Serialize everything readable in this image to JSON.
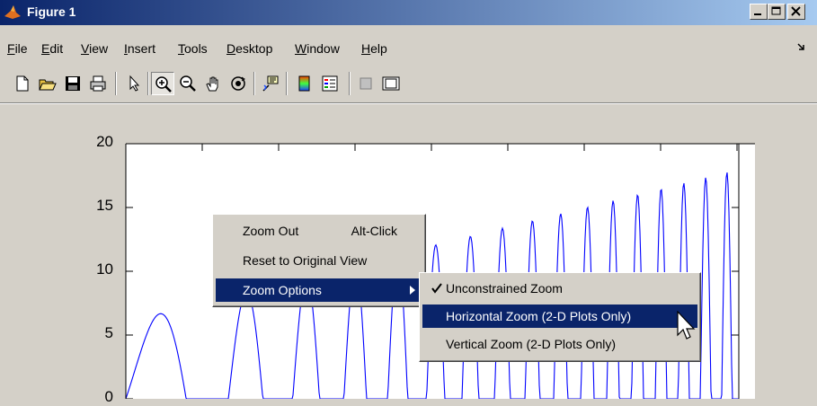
{
  "window": {
    "title": "Figure 1"
  },
  "menubar": [
    {
      "id": "file",
      "label": "File",
      "key": "F",
      "rest": "ile",
      "x": 8
    },
    {
      "id": "edit",
      "label": "Edit",
      "key": "E",
      "rest": "dit",
      "x": 46
    },
    {
      "id": "view",
      "label": "View",
      "key": "V",
      "rest": "iew",
      "x": 90
    },
    {
      "id": "insert",
      "label": "Insert",
      "key": "I",
      "rest": "nsert",
      "x": 138
    },
    {
      "id": "tools",
      "label": "Tools",
      "key": "T",
      "rest": "ools",
      "x": 198
    },
    {
      "id": "desktop",
      "label": "Desktop",
      "key": "D",
      "rest": "esktop",
      "x": 252
    },
    {
      "id": "window",
      "label": "Window",
      "key": "W",
      "rest": "indow",
      "x": 328
    },
    {
      "id": "help",
      "label": "Help",
      "key": "H",
      "rest": "elp",
      "x": 402
    }
  ],
  "context_menu": {
    "items": [
      {
        "label": "Zoom Out",
        "accel": "Alt-Click"
      },
      {
        "label": "Reset to Original View",
        "accel": ""
      },
      {
        "label": "Zoom Options",
        "accel": "",
        "submenu": true,
        "highlighted": true
      }
    ]
  },
  "zoom_submenu": {
    "items": [
      {
        "label": "Unconstrained Zoom",
        "checked": true,
        "highlighted": false
      },
      {
        "label": "Horizontal Zoom (2-D Plots Only)",
        "checked": false,
        "highlighted": true
      },
      {
        "label": "Vertical Zoom (2-D Plots Only)",
        "checked": false,
        "highlighted": false
      }
    ]
  },
  "chart_data": {
    "type": "line",
    "title": "",
    "xlabel": "",
    "ylabel": "",
    "ylim": [
      0,
      20
    ],
    "yticks": [
      "20",
      "15",
      "10",
      "5",
      "0"
    ],
    "series": [
      {
        "color": "#0000ff"
      }
    ]
  },
  "colors": {
    "accent": "#0a246a",
    "plot_line": "#0000ff",
    "background": "#d4d0c8"
  }
}
